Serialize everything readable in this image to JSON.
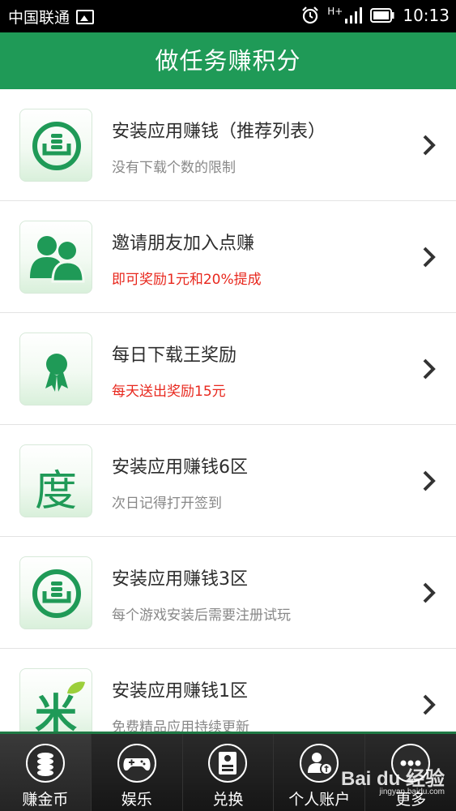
{
  "status_bar": {
    "carrier": "中国联通",
    "network": "H+",
    "time": "10:13"
  },
  "header": {
    "title": "做任务赚积分"
  },
  "tasks": [
    {
      "title": "安装应用赚钱（推荐列表）",
      "subtitle": "没有下载个数的限制",
      "subtitle_color": "#888888",
      "icon": "download-tray-icon"
    },
    {
      "title": "邀请朋友加入点赚",
      "subtitle": "即可奖励1元和20%提成",
      "subtitle_color": "#e8281e",
      "icon": "users-icon"
    },
    {
      "title": "每日下载王奖励",
      "subtitle": "每天送出奖励15元",
      "subtitle_color": "#e8281e",
      "icon": "medal-icon"
    },
    {
      "title": "安装应用赚钱6区",
      "subtitle": "次日记得打开签到",
      "subtitle_color": "#888888",
      "icon": "du-icon",
      "icon_text": "度"
    },
    {
      "title": "安装应用赚钱3区",
      "subtitle": "每个游戏安装后需要注册试玩",
      "subtitle_color": "#888888",
      "icon": "download-tray-icon"
    },
    {
      "title": "安装应用赚钱1区",
      "subtitle": "免费精品应用持续更新",
      "subtitle_color": "#888888",
      "icon": "mi-icon",
      "icon_text": "米"
    }
  ],
  "bottom_nav": [
    {
      "label": "赚金币",
      "icon": "coins-icon",
      "active": true
    },
    {
      "label": "娱乐",
      "icon": "gamepad-icon",
      "active": false
    },
    {
      "label": "兑换",
      "icon": "exchange-icon",
      "active": false
    },
    {
      "label": "个人账户",
      "icon": "account-icon",
      "active": false
    },
    {
      "label": "更多",
      "icon": "more-icon",
      "active": false
    }
  ],
  "watermark": {
    "brand": "Bai du 经验",
    "url": "jingyan.baidu.com"
  },
  "colors": {
    "brand_green": "#1f9a57",
    "highlight_red": "#e8281e"
  }
}
